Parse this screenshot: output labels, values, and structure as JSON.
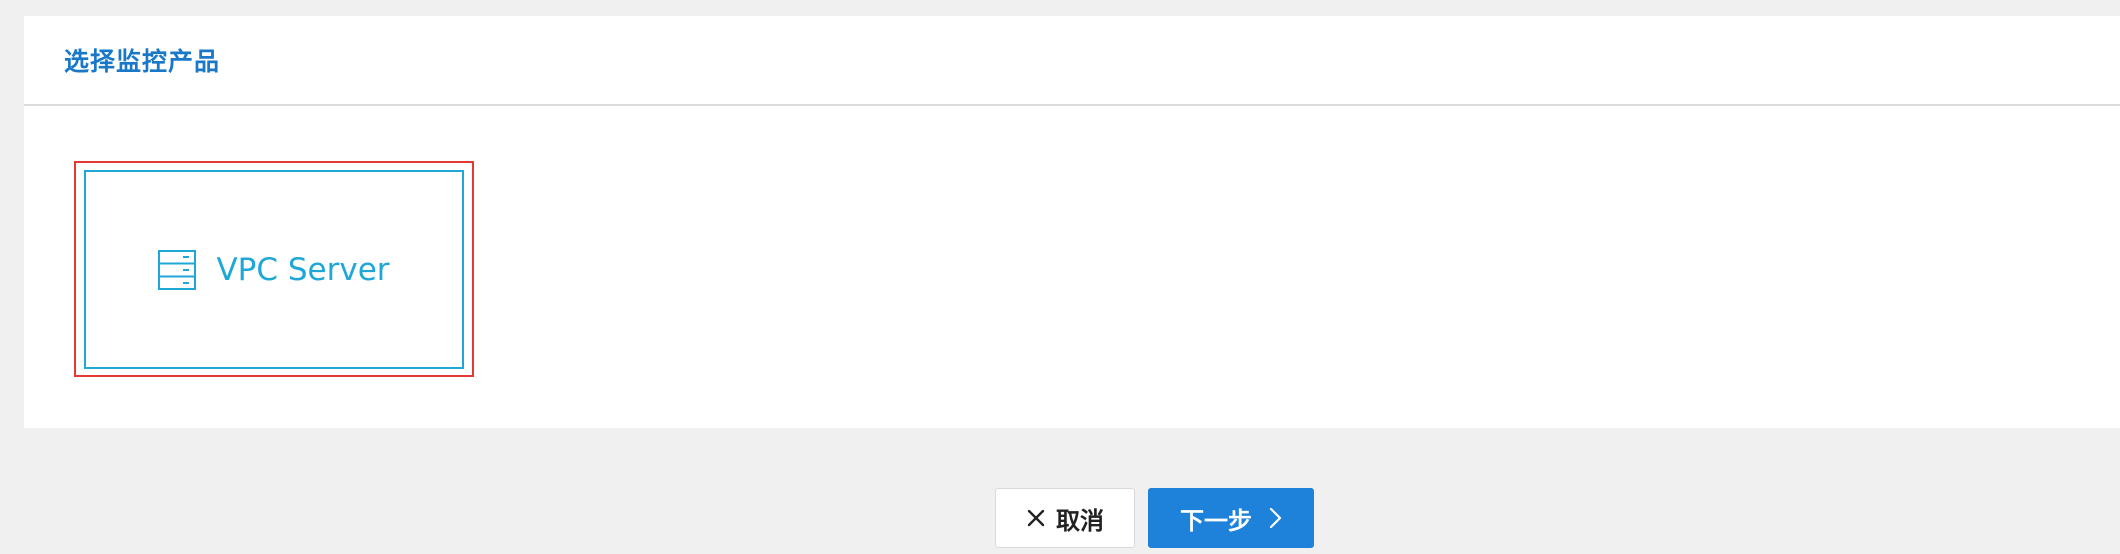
{
  "panel": {
    "title": "选择监控产品"
  },
  "products": [
    {
      "label": "VPC Server",
      "icon": "server-icon"
    }
  ],
  "actions": {
    "cancel_label": "取消",
    "cancel_icon": "close-icon",
    "next_label": "下一步",
    "next_icon": "chevron-right-icon"
  },
  "colors": {
    "accent": "#1e82db",
    "title": "#1a78c8",
    "card_border": "#1fa7d8",
    "selection_outline": "#e53935"
  }
}
